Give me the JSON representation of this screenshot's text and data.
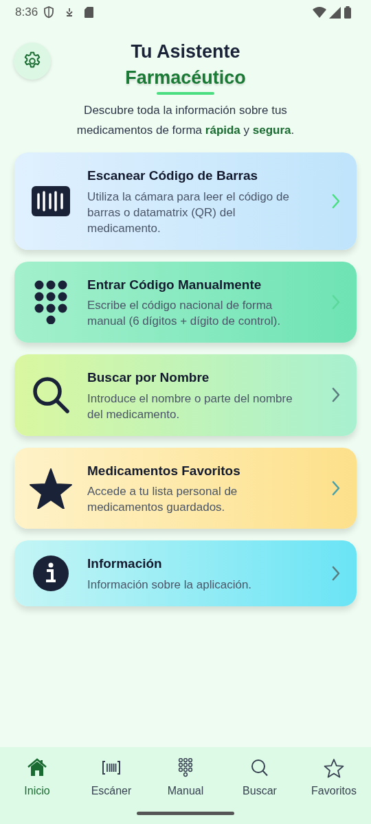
{
  "status_bar": {
    "time": "8:36"
  },
  "header": {
    "title": "Tu Asistente",
    "subtitle": "Farmacéutico",
    "description": "Descubre toda la información sobre tus medicamentos de forma **rápida** y **segura**."
  },
  "cards": [
    {
      "kind": "scan",
      "title": "Escanear Código de Barras",
      "text": "Utiliza la cámara para leer el código de barras o datamatrix (QR) del medicamento."
    },
    {
      "kind": "manual",
      "title": "Entrar Código Manualmente",
      "text": "Escribe el código nacional de forma manual (6 dígitos + dígito de control)."
    },
    {
      "kind": "search",
      "title": "Buscar por Nombre",
      "text": "Introduce el nombre o parte del nombre del medicamento."
    },
    {
      "kind": "favorites",
      "title": "Medicamentos Favoritos",
      "text": "Accede a tu lista personal de medicamentos guardados."
    },
    {
      "kind": "info",
      "title": "Información",
      "text": "Información sobre la aplicación."
    }
  ],
  "tabs": [
    {
      "kind": "home",
      "label": "Inicio",
      "selected": true
    },
    {
      "kind": "scan",
      "label": "Escáner",
      "selected": false
    },
    {
      "kind": "manual",
      "label": "Manual",
      "selected": false
    },
    {
      "kind": "search",
      "label": "Buscar",
      "selected": false
    },
    {
      "kind": "favorites",
      "label": "Favoritos",
      "selected": false
    }
  ]
}
